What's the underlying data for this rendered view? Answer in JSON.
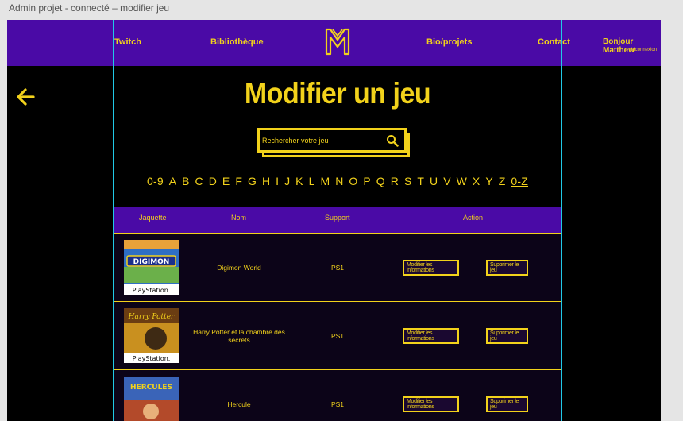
{
  "window": {
    "title": "Admin projet - connecté – modifier jeu"
  },
  "nav": {
    "twitch": "Twitch",
    "library": "Bibliothèque",
    "bio": "Bio/projets",
    "contact": "Contact",
    "greeting": "Bonjour Matthew",
    "logout": "déconnexion"
  },
  "page": {
    "title": "Modifier un jeu"
  },
  "search": {
    "placeholder": "Rechercher votre jeu",
    "value": ""
  },
  "alphabet": [
    "0-9",
    "A",
    "B",
    "C",
    "D",
    "E",
    "F",
    "G",
    "H",
    "I",
    "J",
    "K",
    "L",
    "M",
    "N",
    "O",
    "P",
    "Q",
    "R",
    "S",
    "T",
    "U",
    "V",
    "W",
    "X",
    "Y",
    "Z",
    "0-Z"
  ],
  "table": {
    "headers": {
      "cover": "Jaquette",
      "name": "Nom",
      "support": "Support",
      "action": "Action"
    },
    "rows": [
      {
        "name": "Digimon World",
        "support": "PS1",
        "edit": "Modifier les informations",
        "delete": "Supprimer le jeu",
        "cover_title": "DIGIMON",
        "cover_platform": "PlayStation."
      },
      {
        "name": "Harry Potter et la chambre des secrets",
        "support": "PS1",
        "edit": "Modifier les informations",
        "delete": "Supprimer le jeu",
        "cover_title": "Harry Potter",
        "cover_platform": "PlayStation."
      },
      {
        "name": "Hercule",
        "support": "PS1",
        "edit": "Modifier les informations",
        "delete": "Supprimer le jeu",
        "cover_title": "HERCULES",
        "cover_platform": ""
      }
    ]
  },
  "colors": {
    "accent": "#f2d21b",
    "nav_bg": "#4a0aa6",
    "page_bg": "#000000",
    "guide": "#21c9e6"
  }
}
